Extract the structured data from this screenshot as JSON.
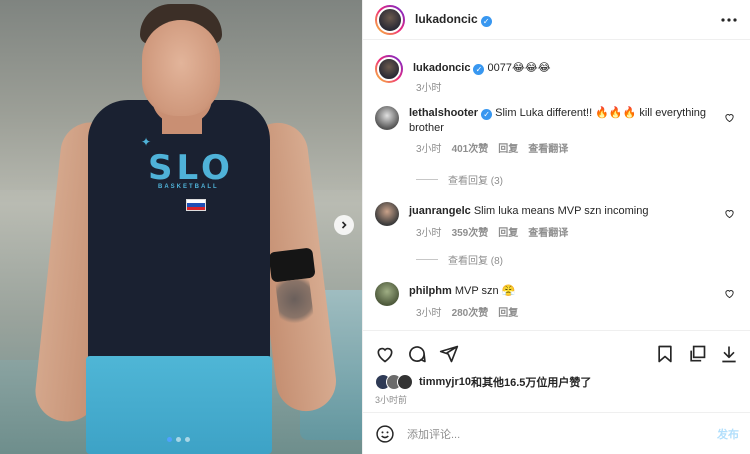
{
  "post": {
    "author": "lukadoncic",
    "photo": {
      "jersey_text": "SLO",
      "jersey_subtext": "BASKETBALL",
      "carousel_dots": 3,
      "active_dot": 0
    }
  },
  "caption": {
    "username": "lukadoncic",
    "text": "0077😂😂😂",
    "time": "3小时"
  },
  "comments": [
    {
      "username": "lethalshooter",
      "verified": true,
      "text": "Slim Luka different!! 🔥🔥🔥 kill everything brother",
      "time": "3小时",
      "likes": "401次赞",
      "reply": "回复",
      "translate": "查看翻译",
      "view_replies": "查看回复 (3)"
    },
    {
      "username": "juanrangelc",
      "verified": false,
      "text": "Slim luka means MVP szn incoming",
      "time": "3小时",
      "likes": "359次赞",
      "reply": "回复",
      "translate": "查看翻译",
      "view_replies": "查看回复 (8)"
    },
    {
      "username": "philphm",
      "verified": false,
      "text": "MVP szn 😤",
      "time": "3小时",
      "likes": "280次赞",
      "reply": "回复"
    }
  ],
  "likes_line": {
    "username": "timmyjr10",
    "rest": "和其他16.5万位用户赞了"
  },
  "post_time": "3小时前",
  "add_comment": {
    "placeholder": "添加评论...",
    "post_label": "发布"
  },
  "icons": {
    "header_more": "more-horizontal-icon",
    "like": "heart-icon",
    "comment": "comment-icon",
    "share": "send-icon",
    "save": "bookmark-icon",
    "add_collection": "copy-icon",
    "download": "download-icon",
    "emoji": "smiley-icon",
    "carousel_next": "chevron-right-icon"
  },
  "colors": {
    "verified": "#3897f0",
    "link_gray": "#8e8e8e",
    "post_disabled": "#b2dffc",
    "carousel_active": "#4ea1ff"
  }
}
